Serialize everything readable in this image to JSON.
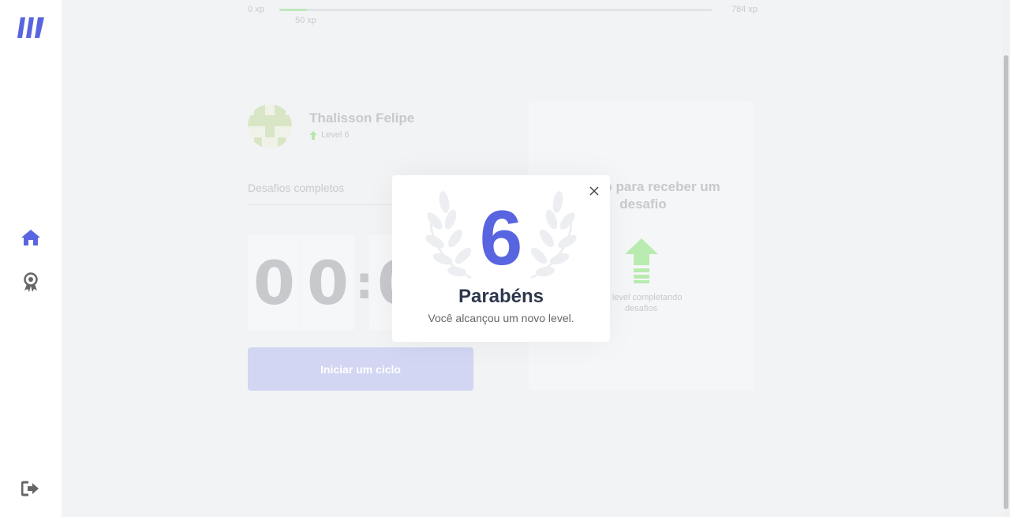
{
  "sidebar": {
    "nav": [
      {
        "icon": "home-icon",
        "active": true
      },
      {
        "icon": "award-icon",
        "active": false
      }
    ],
    "logout_icon": "logout-icon"
  },
  "xp": {
    "start": "0 xp",
    "current": "50 xp",
    "end": "784 xp",
    "progress_percent": 6.4
  },
  "profile": {
    "name": "Thalisson Felipe",
    "level": "Level 6"
  },
  "challenges": {
    "label": "Desafios completos"
  },
  "countdown": {
    "digits": [
      "0",
      "0",
      "0"
    ],
    "separator": ":"
  },
  "actions": {
    "start_cycle": "Iniciar um ciclo"
  },
  "challenge_card": {
    "title": "m ciclo para receber um desafio",
    "description": "de level completando desafios"
  },
  "modal": {
    "level": "6",
    "title": "Parabéns",
    "message": "Você alcançou um novo level."
  },
  "colors": {
    "accent": "#5965e0",
    "text_dark": "#2e384d",
    "green": "#4cd62b"
  }
}
